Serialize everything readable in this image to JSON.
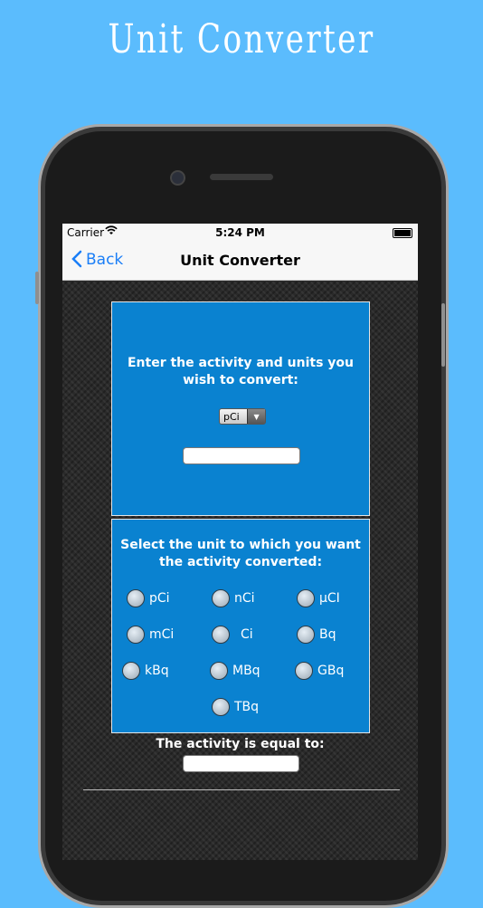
{
  "banner_title": "Unit Converter",
  "status": {
    "carrier": "Carrier",
    "time": "5:24 PM"
  },
  "nav": {
    "back_label": "Back",
    "title": "Unit Converter"
  },
  "input_panel": {
    "prompt_line1": "Enter the activity and units you",
    "prompt_line2": "wish to convert:",
    "unit_select": "pCi",
    "activity_value": ""
  },
  "target_panel": {
    "prompt_line1": "Select the unit to which you want",
    "prompt_line2": "the activity converted:",
    "options": [
      "pCi",
      "nCi",
      "μCI",
      "mCi",
      "Ci",
      "Bq",
      "kBq",
      "MBq",
      "GBq",
      "TBq"
    ]
  },
  "result": {
    "label": "The activity is equal to:",
    "value": ""
  },
  "icons": {
    "wifi": "wifi-icon",
    "battery": "battery-icon",
    "back": "chevron-left-icon",
    "dropdown": "dropdown-arrow-icon"
  },
  "colors": {
    "background": "#5bbcfd",
    "panel": "#0a82d0",
    "link": "#1a7ef7"
  }
}
